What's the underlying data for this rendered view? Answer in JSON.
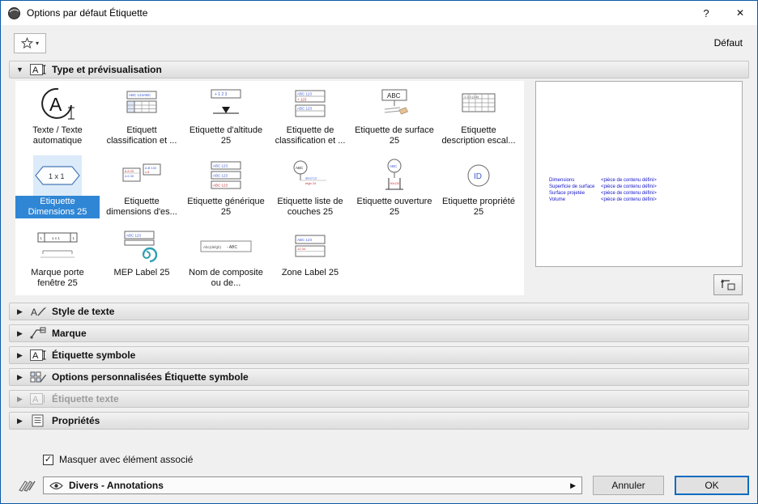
{
  "window": {
    "title": "Options par défaut Étiquette",
    "help_label": "?",
    "close_label": "✕"
  },
  "icons": {
    "star": "☆",
    "fav_caret": "▾",
    "expanded": "▼",
    "collapsed": "▶",
    "check": "✓",
    "combo_arrow": "▶"
  },
  "topbar": {
    "default_label": "Défaut"
  },
  "sections": {
    "type_preview": {
      "label": "Type et prévisualisation",
      "expanded": true
    },
    "collapsed": [
      {
        "label": "Style de texte",
        "disabled": false
      },
      {
        "label": "Marque",
        "disabled": false
      },
      {
        "label": "Étiquette symbole",
        "disabled": false
      },
      {
        "label": "Options personnalisées Étiquette symbole",
        "disabled": false
      },
      {
        "label": "Étiquette texte",
        "disabled": true
      },
      {
        "label": "Propriétés",
        "disabled": false
      }
    ]
  },
  "grid": {
    "items": [
      {
        "label": "Texte / Texte automatique",
        "selected": false
      },
      {
        "label": "Etiquett classification et ...",
        "selected": false
      },
      {
        "label": "Etiquette d'altitude 25",
        "selected": false
      },
      {
        "label": "Etiquette de classification et ...",
        "selected": false
      },
      {
        "label": "Etiquette de surface 25",
        "selected": false
      },
      {
        "label": "Etiquette description escal...",
        "selected": false
      },
      {
        "label": "Etiquette Dimensions 25",
        "selected": true
      },
      {
        "label": "Etiquette dimensions d'es...",
        "selected": false
      },
      {
        "label": "Etiquette générique 25",
        "selected": false
      },
      {
        "label": "Etiquette liste de couches 25",
        "selected": false
      },
      {
        "label": "Etiquette ouverture 25",
        "selected": false
      },
      {
        "label": "Etiquette propriété 25",
        "selected": false
      },
      {
        "label": "Marque porte fenêtre 25",
        "selected": false
      },
      {
        "label": "MEP Label 25",
        "selected": false
      },
      {
        "label": "Nom de composite ou de...",
        "selected": false
      },
      {
        "label": "Zone Label 25",
        "selected": false
      }
    ]
  },
  "preview": {
    "rows": [
      {
        "name": "Dimensions",
        "value": "<pièce de contenu défini>"
      },
      {
        "name": "Superficie de surface",
        "value": "<pièce de contenu défini>"
      },
      {
        "name": "Surface projetée",
        "value": "<pièce de contenu défini>"
      },
      {
        "name": "Volume",
        "value": "<pièce de contenu défini>"
      }
    ]
  },
  "footer": {
    "hide_checkbox_label": "Masquer avec élément associé",
    "hide_checkbox_checked": true,
    "layer_name": "Divers - Annotations",
    "cancel_label": "Annuler",
    "ok_label": "OK"
  }
}
